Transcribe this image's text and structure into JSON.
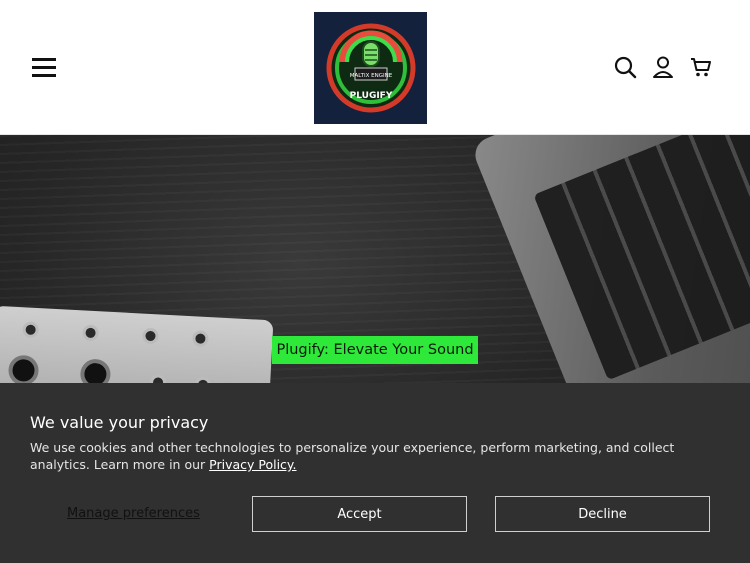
{
  "header": {
    "logo_text": "PLUGIFY",
    "logo_small_text": "MALTIX ENGINE",
    "icons": [
      "menu-icon",
      "search-icon",
      "account-icon",
      "cart-icon"
    ]
  },
  "hero": {
    "tagline": "Plugify: Elevate Your Sound",
    "accent_color": "#2ee83a"
  },
  "cookie": {
    "title": "We value your privacy",
    "body": "We use cookies and other technologies to personalize your experience, perform marketing, and collect analytics. Learn more in our ",
    "policy_link": "Privacy Policy.",
    "manage_label": "Manage preferences",
    "accept_label": "Accept",
    "decline_label": "Decline"
  }
}
